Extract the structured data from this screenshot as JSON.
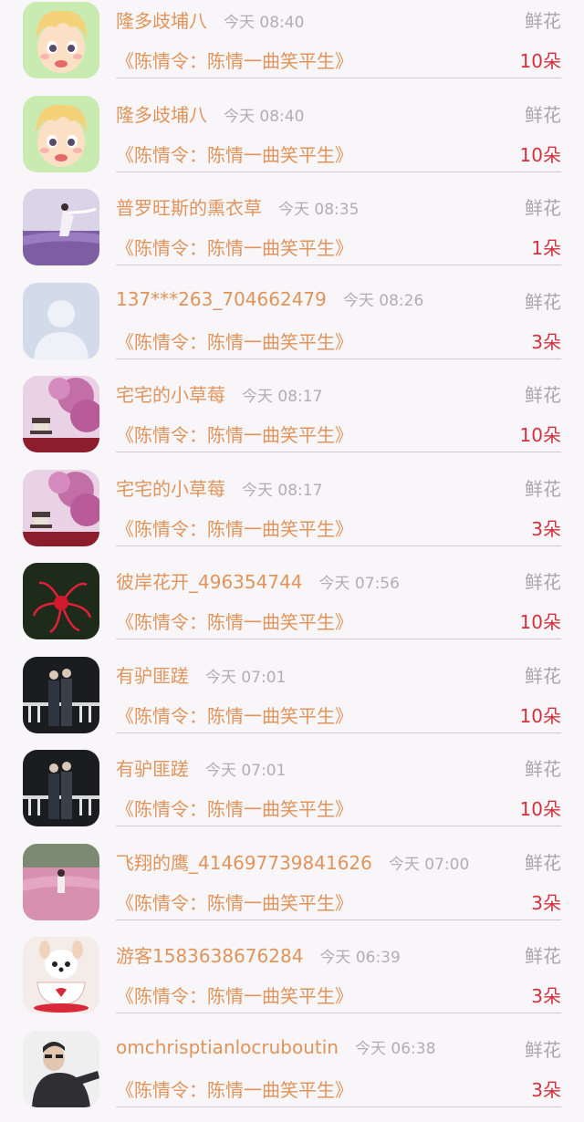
{
  "gifts": [
    {
      "name": "隆多歧埔八",
      "time": "今天 08:40",
      "type": "鲜花",
      "book": "《陈情令：陈情一曲笑平生》",
      "count": "10朵",
      "avatar": "cartoon-boy-avatar"
    },
    {
      "name": "隆多歧埔八",
      "time": "今天 08:40",
      "type": "鲜花",
      "book": "《陈情令：陈情一曲笑平生》",
      "count": "10朵",
      "avatar": "cartoon-boy-avatar"
    },
    {
      "name": "普罗旺斯的熏衣草",
      "time": "今天 08:35",
      "type": "鲜花",
      "book": "《陈情令：陈情一曲笑平生》",
      "count": "1朵",
      "avatar": "lavender-field-avatar"
    },
    {
      "name": "137***263_704662479",
      "time": "今天 08:26",
      "type": "鲜花",
      "book": "《陈情令：陈情一曲笑平生》",
      "count": "3朵",
      "avatar": "default-user-avatar"
    },
    {
      "name": "宅宅的小草莓",
      "time": "今天 08:17",
      "type": "鲜花",
      "book": "《陈情令：陈情一曲笑平生》",
      "count": "10朵",
      "avatar": "cherry-blossom-avatar"
    },
    {
      "name": "宅宅的小草莓",
      "time": "今天 08:17",
      "type": "鲜花",
      "book": "《陈情令：陈情一曲笑平生》",
      "count": "3朵",
      "avatar": "cherry-blossom-avatar"
    },
    {
      "name": "彼岸花开_496354744",
      "time": "今天 07:56",
      "type": "鲜花",
      "book": "《陈情令：陈情一曲笑平生》",
      "count": "10朵",
      "avatar": "red-spider-lily-avatar"
    },
    {
      "name": "有驴匪蹉",
      "time": "今天 07:01",
      "type": "鲜花",
      "book": "《陈情令：陈情一曲笑平生》",
      "count": "10朵",
      "avatar": "couple-night-avatar"
    },
    {
      "name": "有驴匪蹉",
      "time": "今天 07:01",
      "type": "鲜花",
      "book": "《陈情令：陈情一曲笑平生》",
      "count": "10朵",
      "avatar": "couple-night-avatar"
    },
    {
      "name": "飞翔的鹰_414697739841626",
      "time": "今天 07:00",
      "type": "鲜花",
      "book": "《陈情令：陈情一曲笑平生》",
      "count": "3朵",
      "avatar": "pink-grass-avatar"
    },
    {
      "name": "游客1583638676284",
      "time": "今天 06:39",
      "type": "鲜花",
      "book": "《陈情令：陈情一曲笑平生》",
      "count": "3朵",
      "avatar": "puppy-teacup-avatar"
    },
    {
      "name": "omchrisptianlocruboutin",
      "time": "今天 06:38",
      "type": "鲜花",
      "book": "《陈情令：陈情一曲笑平生》",
      "count": "3朵",
      "avatar": "man-portrait-avatar"
    }
  ]
}
